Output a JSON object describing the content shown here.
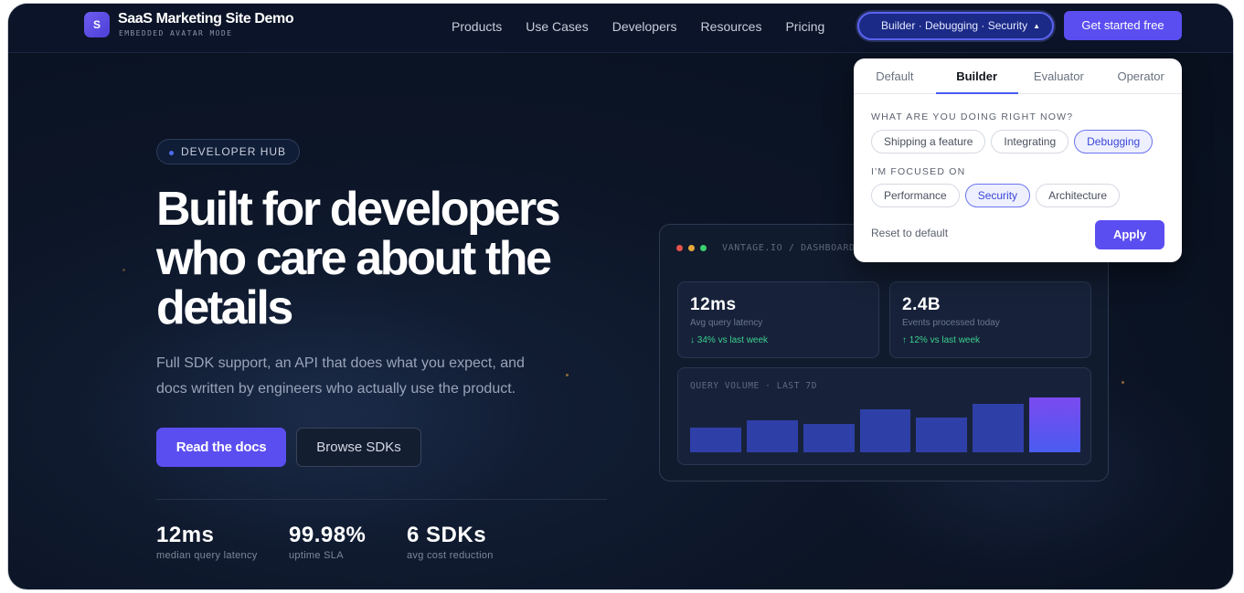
{
  "brand": {
    "logo_letter": "S",
    "title": "SaaS Marketing Site Demo",
    "subtitle": "EMBEDDED AVATAR MODE"
  },
  "nav": {
    "links": [
      "Products",
      "Use Cases",
      "Developers",
      "Resources",
      "Pricing"
    ],
    "mode_selector": "Builder · Debugging · Security",
    "cta": "Get started free"
  },
  "hero": {
    "badge": "DEVELOPER HUB",
    "headline": "Built for developers who care about the details",
    "subtext": "Full SDK support, an API that does what you expect, and docs written by engineers who actually use the product.",
    "primary_button": "Read the docs",
    "secondary_button": "Browse SDKs",
    "stats": [
      {
        "value": "12ms",
        "label": "median query latency"
      },
      {
        "value": "99.98%",
        "label": "uptime SLA"
      },
      {
        "value": "6 SDKs",
        "label": "avg cost reduction"
      }
    ]
  },
  "dashboard": {
    "path": "VANTAGE.IO / DASHBOARD",
    "window_dot_colors": [
      "#e5534b",
      "#e5a93b",
      "#3ccf6e"
    ],
    "metrics": [
      {
        "value": "12ms",
        "label": "Avg query latency",
        "trend": "↓ 34% vs last week"
      },
      {
        "value": "2.4B",
        "label": "Events processed today",
        "trend": "↑ 12% vs last week"
      }
    ],
    "chart_title": "QUERY VOLUME · LAST 7D",
    "chart_values": [
      26,
      34,
      30,
      45,
      37,
      51,
      58
    ]
  },
  "popover": {
    "tabs": [
      "Default",
      "Builder",
      "Evaluator",
      "Operator"
    ],
    "active_tab": "Builder",
    "section1_label": "WHAT ARE YOU DOING RIGHT NOW?",
    "section1_options": [
      "Shipping a feature",
      "Integrating",
      "Debugging"
    ],
    "section1_selected": "Debugging",
    "section2_label": "I'M FOCUSED ON",
    "section2_options": [
      "Performance",
      "Security",
      "Architecture"
    ],
    "section2_selected": "Security",
    "reset_label": "Reset to default",
    "apply_label": "Apply"
  },
  "colors": {
    "accent": "#5b4ef0",
    "background": "#0c1526",
    "trend_positive": "#3ccf8e"
  }
}
